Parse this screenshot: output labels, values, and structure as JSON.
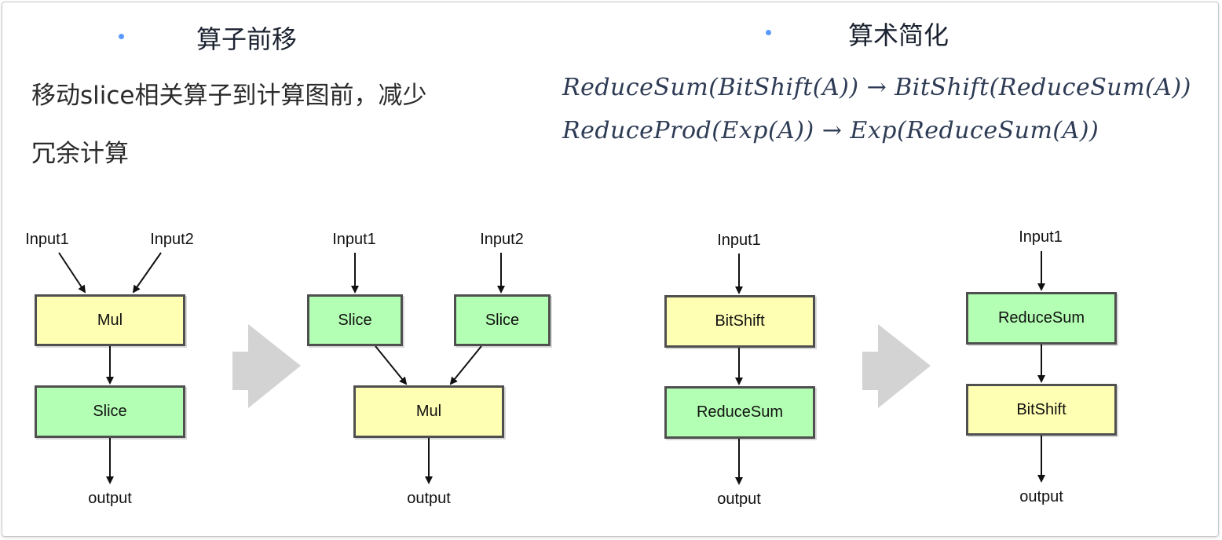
{
  "left": {
    "heading": "算子前移",
    "description_line1": "移动slice相关算子到计算图前，减少",
    "description_line2": "冗余计算"
  },
  "right": {
    "heading": "算术简化",
    "formula1": "ReduceSum(BitShift(A)) → BitShift(ReduceSum(A))",
    "formula2": "ReduceProd(Exp(A)) → Exp(ReduceSum(A))"
  },
  "diagrams": {
    "d1": {
      "input1": "Input1",
      "input2": "Input2",
      "node_top": "Mul",
      "node_bottom": "Slice",
      "output": "output"
    },
    "d2": {
      "input1": "Input1",
      "input2": "Input2",
      "node_left": "Slice",
      "node_right": "Slice",
      "node_bottom": "Mul",
      "output": "output"
    },
    "d3": {
      "input1": "Input1",
      "node_top": "BitShift",
      "node_bottom": "ReduceSum",
      "output": "output"
    },
    "d4": {
      "input1": "Input1",
      "node_top": "ReduceSum",
      "node_bottom": "BitShift",
      "output": "output"
    }
  },
  "colors": {
    "yellow_node": "#ffffb3",
    "green_node": "#b3ffb3",
    "bullet": "#5b9bff",
    "transform_arrow": "#d3d3d3"
  }
}
